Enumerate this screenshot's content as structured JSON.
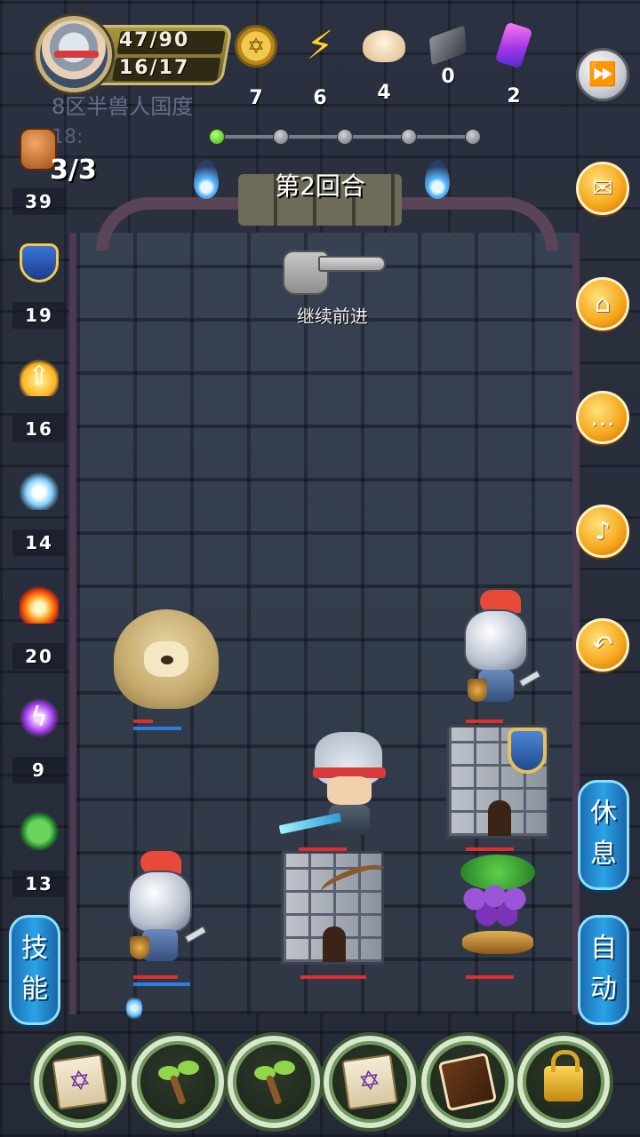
{
  "hud": {
    "hp": "47/90",
    "sp": "16/17",
    "resources": [
      {
        "icon": "gold-coin-icon",
        "value": "7"
      },
      {
        "icon": "energy-bolt-icon",
        "value": "6"
      },
      {
        "icon": "steamed-bun-icon",
        "value": "4"
      },
      {
        "icon": "iron-ore-icon",
        "value": "0"
      },
      {
        "icon": "purple-crystal-icon",
        "value": "2"
      }
    ],
    "overlay_text": "8区半兽人国度",
    "overlay_text2": "18:"
  },
  "progress": {
    "total_nodes": 5,
    "current_node": 1
  },
  "round": {
    "label": "第2回合"
  },
  "guide": {
    "continue_label": "继续前进"
  },
  "stats": {
    "attack_ratio": "3/3",
    "items": [
      {
        "icon": "fist-icon",
        "value": "39"
      },
      {
        "icon": "shield-icon",
        "value": "19"
      },
      {
        "icon": "level-up-icon",
        "value": "16"
      },
      {
        "icon": "water-icon",
        "value": "14"
      },
      {
        "icon": "fire-icon",
        "value": "20"
      },
      {
        "icon": "lightning-icon",
        "value": "9"
      },
      {
        "icon": "poison-icon",
        "value": "13"
      }
    ]
  },
  "side_buttons": {
    "rest": [
      "休",
      "息"
    ],
    "auto": [
      "自",
      "动"
    ],
    "skill": [
      "技",
      "能"
    ]
  },
  "units": {
    "dog": {
      "hp": 0.4,
      "mp": 1.0
    },
    "knight_top": {
      "hp": 0.8,
      "mp": 1.0
    },
    "hero": {
      "hp": 0.9,
      "mp": 1.0
    },
    "tower_shield": {
      "hp": 1.0
    },
    "knight_bottom": {
      "hp": 1.0,
      "mp": 1.0
    },
    "tower_bow": {
      "hp": 1.0
    },
    "grapes": {
      "hp": 1.0
    }
  },
  "skills": [
    {
      "icon": "magic-scroll-icon",
      "locked": false
    },
    {
      "icon": "sprout-icon",
      "locked": false
    },
    {
      "icon": "sprout-icon",
      "locked": false
    },
    {
      "icon": "magic-scroll-icon",
      "locked": false
    },
    {
      "icon": "chocolate-icon",
      "locked": false
    },
    {
      "icon": "lock-icon",
      "locked": true
    }
  ],
  "colors": {
    "accent": "#f5a51b",
    "blue_button": "#2aa3e8",
    "hp_bar": "#e02d2d",
    "mp_bar": "#2d7de0"
  }
}
